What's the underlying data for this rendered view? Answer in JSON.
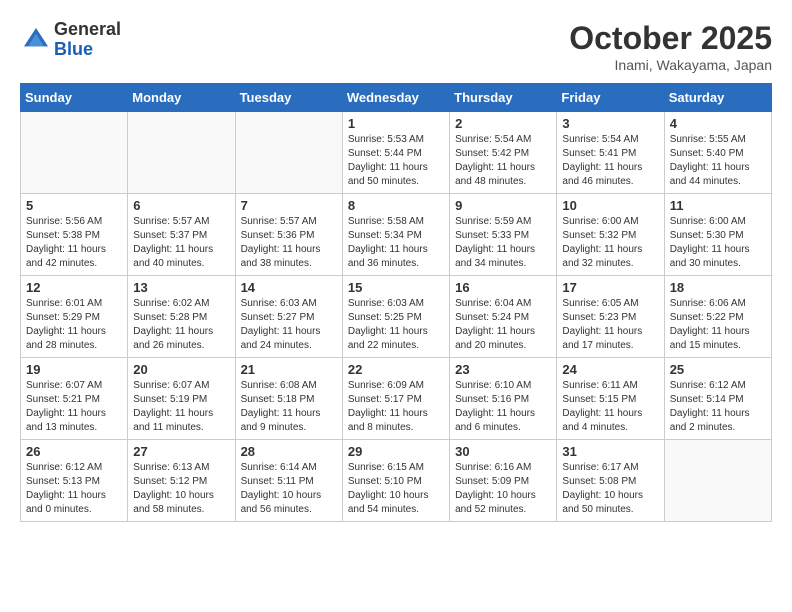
{
  "logo": {
    "general": "General",
    "blue": "Blue"
  },
  "header": {
    "month": "October 2025",
    "location": "Inami, Wakayama, Japan"
  },
  "weekdays": [
    "Sunday",
    "Monday",
    "Tuesday",
    "Wednesday",
    "Thursday",
    "Friday",
    "Saturday"
  ],
  "weeks": [
    [
      {
        "day": "",
        "info": ""
      },
      {
        "day": "",
        "info": ""
      },
      {
        "day": "",
        "info": ""
      },
      {
        "day": "1",
        "info": "Sunrise: 5:53 AM\nSunset: 5:44 PM\nDaylight: 11 hours\nand 50 minutes."
      },
      {
        "day": "2",
        "info": "Sunrise: 5:54 AM\nSunset: 5:42 PM\nDaylight: 11 hours\nand 48 minutes."
      },
      {
        "day": "3",
        "info": "Sunrise: 5:54 AM\nSunset: 5:41 PM\nDaylight: 11 hours\nand 46 minutes."
      },
      {
        "day": "4",
        "info": "Sunrise: 5:55 AM\nSunset: 5:40 PM\nDaylight: 11 hours\nand 44 minutes."
      }
    ],
    [
      {
        "day": "5",
        "info": "Sunrise: 5:56 AM\nSunset: 5:38 PM\nDaylight: 11 hours\nand 42 minutes."
      },
      {
        "day": "6",
        "info": "Sunrise: 5:57 AM\nSunset: 5:37 PM\nDaylight: 11 hours\nand 40 minutes."
      },
      {
        "day": "7",
        "info": "Sunrise: 5:57 AM\nSunset: 5:36 PM\nDaylight: 11 hours\nand 38 minutes."
      },
      {
        "day": "8",
        "info": "Sunrise: 5:58 AM\nSunset: 5:34 PM\nDaylight: 11 hours\nand 36 minutes."
      },
      {
        "day": "9",
        "info": "Sunrise: 5:59 AM\nSunset: 5:33 PM\nDaylight: 11 hours\nand 34 minutes."
      },
      {
        "day": "10",
        "info": "Sunrise: 6:00 AM\nSunset: 5:32 PM\nDaylight: 11 hours\nand 32 minutes."
      },
      {
        "day": "11",
        "info": "Sunrise: 6:00 AM\nSunset: 5:30 PM\nDaylight: 11 hours\nand 30 minutes."
      }
    ],
    [
      {
        "day": "12",
        "info": "Sunrise: 6:01 AM\nSunset: 5:29 PM\nDaylight: 11 hours\nand 28 minutes."
      },
      {
        "day": "13",
        "info": "Sunrise: 6:02 AM\nSunset: 5:28 PM\nDaylight: 11 hours\nand 26 minutes."
      },
      {
        "day": "14",
        "info": "Sunrise: 6:03 AM\nSunset: 5:27 PM\nDaylight: 11 hours\nand 24 minutes."
      },
      {
        "day": "15",
        "info": "Sunrise: 6:03 AM\nSunset: 5:25 PM\nDaylight: 11 hours\nand 22 minutes."
      },
      {
        "day": "16",
        "info": "Sunrise: 6:04 AM\nSunset: 5:24 PM\nDaylight: 11 hours\nand 20 minutes."
      },
      {
        "day": "17",
        "info": "Sunrise: 6:05 AM\nSunset: 5:23 PM\nDaylight: 11 hours\nand 17 minutes."
      },
      {
        "day": "18",
        "info": "Sunrise: 6:06 AM\nSunset: 5:22 PM\nDaylight: 11 hours\nand 15 minutes."
      }
    ],
    [
      {
        "day": "19",
        "info": "Sunrise: 6:07 AM\nSunset: 5:21 PM\nDaylight: 11 hours\nand 13 minutes."
      },
      {
        "day": "20",
        "info": "Sunrise: 6:07 AM\nSunset: 5:19 PM\nDaylight: 11 hours\nand 11 minutes."
      },
      {
        "day": "21",
        "info": "Sunrise: 6:08 AM\nSunset: 5:18 PM\nDaylight: 11 hours\nand 9 minutes."
      },
      {
        "day": "22",
        "info": "Sunrise: 6:09 AM\nSunset: 5:17 PM\nDaylight: 11 hours\nand 8 minutes."
      },
      {
        "day": "23",
        "info": "Sunrise: 6:10 AM\nSunset: 5:16 PM\nDaylight: 11 hours\nand 6 minutes."
      },
      {
        "day": "24",
        "info": "Sunrise: 6:11 AM\nSunset: 5:15 PM\nDaylight: 11 hours\nand 4 minutes."
      },
      {
        "day": "25",
        "info": "Sunrise: 6:12 AM\nSunset: 5:14 PM\nDaylight: 11 hours\nand 2 minutes."
      }
    ],
    [
      {
        "day": "26",
        "info": "Sunrise: 6:12 AM\nSunset: 5:13 PM\nDaylight: 11 hours\nand 0 minutes."
      },
      {
        "day": "27",
        "info": "Sunrise: 6:13 AM\nSunset: 5:12 PM\nDaylight: 10 hours\nand 58 minutes."
      },
      {
        "day": "28",
        "info": "Sunrise: 6:14 AM\nSunset: 5:11 PM\nDaylight: 10 hours\nand 56 minutes."
      },
      {
        "day": "29",
        "info": "Sunrise: 6:15 AM\nSunset: 5:10 PM\nDaylight: 10 hours\nand 54 minutes."
      },
      {
        "day": "30",
        "info": "Sunrise: 6:16 AM\nSunset: 5:09 PM\nDaylight: 10 hours\nand 52 minutes."
      },
      {
        "day": "31",
        "info": "Sunrise: 6:17 AM\nSunset: 5:08 PM\nDaylight: 10 hours\nand 50 minutes."
      },
      {
        "day": "",
        "info": ""
      }
    ]
  ]
}
